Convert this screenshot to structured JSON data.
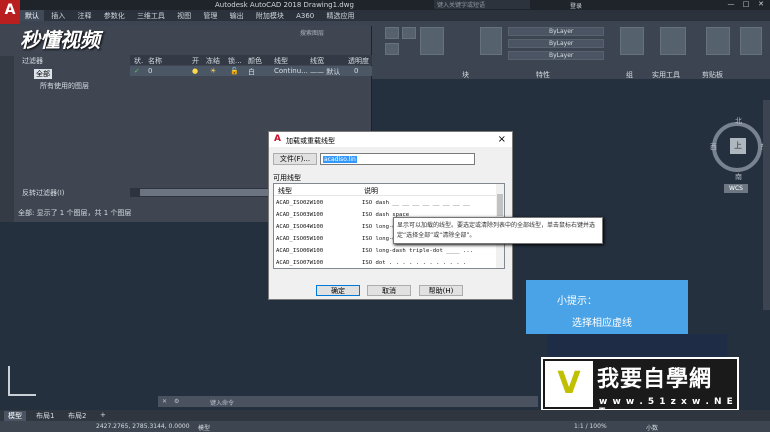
{
  "titlebar": {
    "title": "Autodesk AutoCAD 2018    Drawing1.dwg",
    "search_placeholder": "键入关键字或短语",
    "login_label": "登录",
    "minimize": "—",
    "maximize": "□",
    "close": "✕"
  },
  "app_button": "A",
  "menu": [
    "默认",
    "插入",
    "注释",
    "参数化",
    "三维工具",
    "视图",
    "管理",
    "输出",
    "附加模块",
    "A360",
    "精选应用"
  ],
  "ribbon": {
    "groups": [
      "块",
      "特性",
      "组",
      "实用工具",
      "剪贴板"
    ],
    "bylayer_1": "ByLayer",
    "bylayer_2": "ByLayer",
    "bylayer_3": "ByLayer",
    "search_layer": "搜索图层"
  },
  "watermark": "秒懂视频",
  "layer_panel": {
    "filters_label": "过滤器",
    "tree_all": "全部",
    "tree_used": "所有使用的图层",
    "invert_filter": "反转过滤器(I)",
    "status_text": "全部: 显示了 1 个图层，共 1 个图层",
    "headers": [
      "状.",
      "名称",
      "开",
      "冻结",
      "锁...",
      "颜色",
      "线型",
      "线宽",
      "透明度"
    ],
    "row": {
      "status": "✓",
      "name": "0",
      "on": "●",
      "freeze": "☀",
      "lock": "🔓",
      "color": "白",
      "linetype": "Continu...",
      "lineweight": "—— 默认",
      "transparency": "0"
    }
  },
  "dialog": {
    "title": "加载或重载线型",
    "file_button": "文件(F)...",
    "file_value": "acadiso.lin",
    "available_label": "可用线型",
    "col_linetype": "线型",
    "col_desc": "说明",
    "rows": [
      {
        "name": "ACAD_ISO02W100",
        "desc": "ISO dash __ __ __ __ __ __ __ __"
      },
      {
        "name": "ACAD_ISO03W100",
        "desc": "ISO dash space ___    ___    ___"
      },
      {
        "name": "ACAD_ISO04W100",
        "desc": "ISO long-dash dot ____ . ____ ."
      },
      {
        "name": "ACAD_ISO05W100",
        "desc": "ISO long-dash double-dot ____ .."
      },
      {
        "name": "ACAD_ISO06W100",
        "desc": "ISO long-dash triple-dot ____ ..."
      },
      {
        "name": "ACAD_ISO07W100",
        "desc": "ISO dot . . . . . . . . . . . ."
      }
    ],
    "ok": "确定",
    "cancel": "取消",
    "help": "帮助(H)"
  },
  "tooltip": "显示可以加载的线型。要选定或清除列表中的全部线型，单击鼠标右键并选定“选择全部”或“清除全部”。",
  "hint": {
    "line1": "小提示：",
    "line2": "选择相应虚线"
  },
  "logo": {
    "big": "我要自學網",
    "url": "w w w . 5 1 z x w . N E T",
    "mark": "V"
  },
  "viewcube": {
    "north": "北",
    "south": "南",
    "west": "西",
    "east": "东",
    "top": "上",
    "wcs": "WCS"
  },
  "command_line": {
    "placeholder": "键入命令"
  },
  "tabs": [
    "模型",
    "布局1",
    "布局2",
    "+"
  ],
  "statusbar": {
    "coords": "2427.2765, 2785.3144, 0.0000",
    "model": "模型",
    "scale": "1:1 / 100%",
    "units": "小数"
  }
}
